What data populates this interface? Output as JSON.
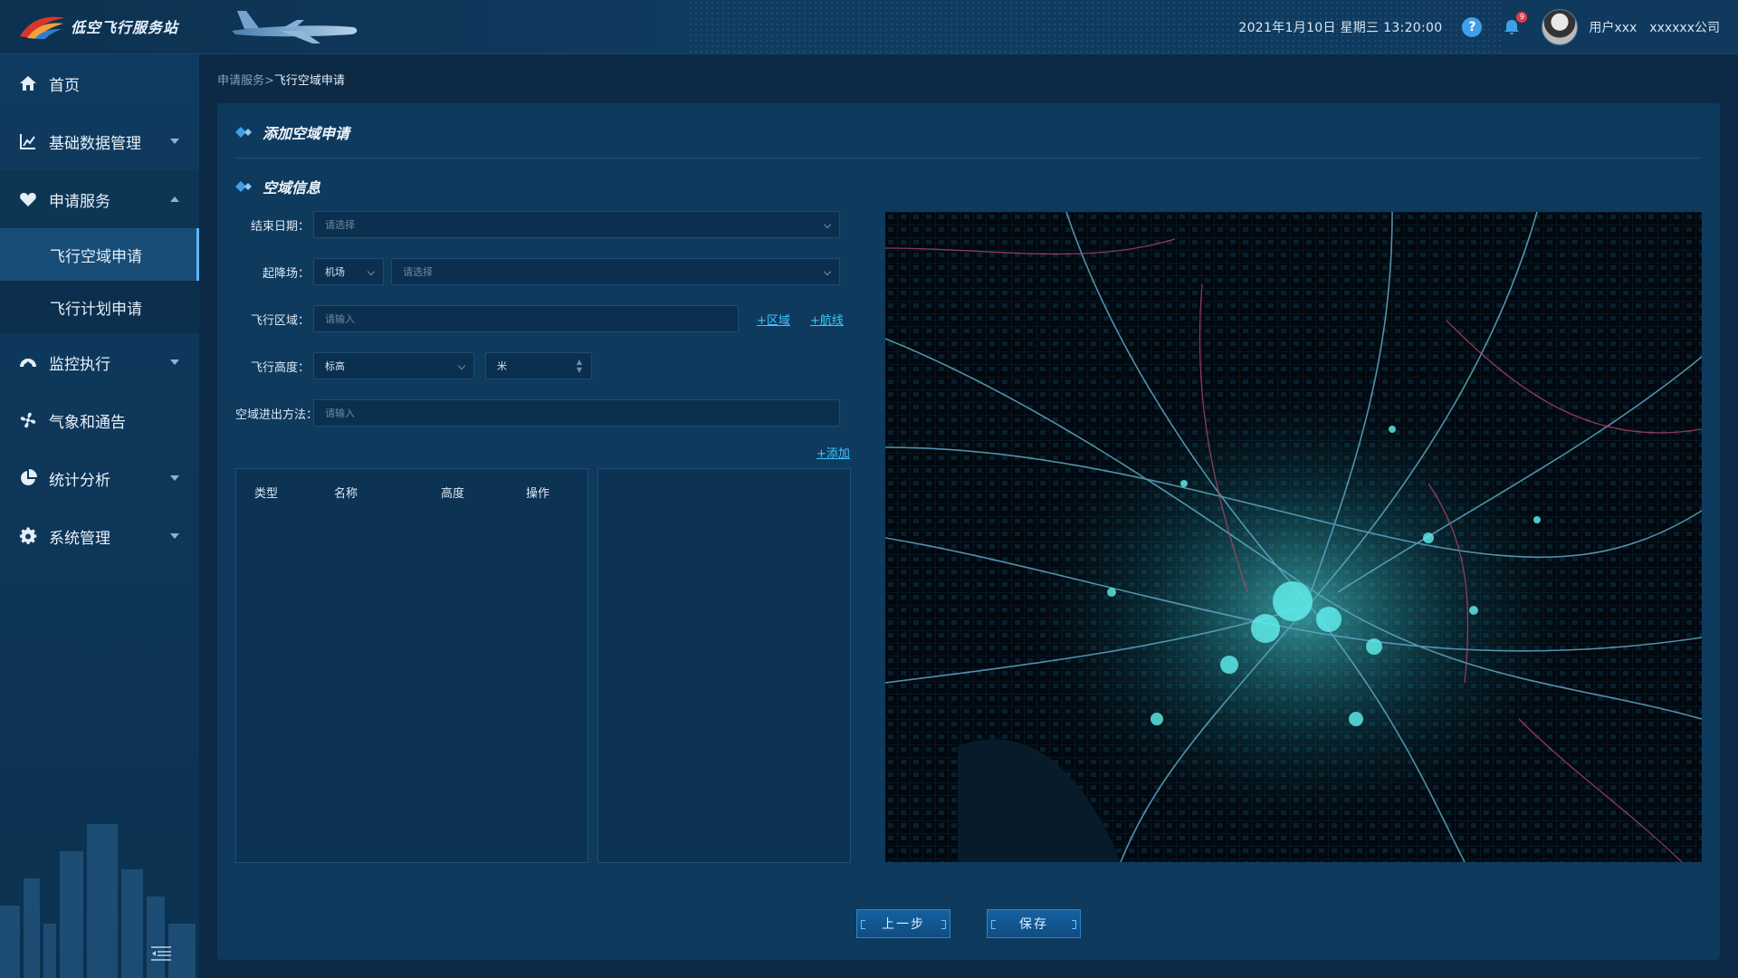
{
  "app": {
    "title": "低空飞行服务站"
  },
  "header": {
    "datetime": "2021年1月10日  星期三  13:20:00",
    "notification_count": "9",
    "user": "用户xxx",
    "company": "xxxxxx公司",
    "icons": [
      "help-icon",
      "bell-icon",
      "avatar"
    ]
  },
  "sidebar": {
    "items": [
      {
        "label": "首页",
        "icon": "home-icon"
      },
      {
        "label": "基础数据管理",
        "icon": "chart-icon"
      },
      {
        "label": "申请服务",
        "icon": "heart-icon"
      },
      {
        "label": "监控执行",
        "icon": "dashboard-icon"
      },
      {
        "label": "气象和通告",
        "icon": "fan-icon"
      },
      {
        "label": "统计分析",
        "icon": "pie-icon"
      },
      {
        "label": "系统管理",
        "icon": "gear-icon"
      }
    ],
    "sub_items": [
      {
        "label": "飞行空域申请",
        "active": true
      },
      {
        "label": "飞行计划申请",
        "active": false
      }
    ]
  },
  "breadcrumb": {
    "parent": "申请服务>",
    "current": "飞行空域申请"
  },
  "page": {
    "section1": "添加空域申请",
    "section2": "空域信息"
  },
  "form": {
    "end_date": {
      "label": "结束日期：",
      "placeholder": "请选择"
    },
    "airport": {
      "label": "起降场：",
      "type_value": "机场",
      "placeholder": "请选择"
    },
    "area": {
      "label": "飞行区域：",
      "placeholder": "请输入",
      "add_area": "+区域",
      "add_route": "+航线"
    },
    "altitude": {
      "label": "飞行高度：",
      "type_value": "标高",
      "unit_value": "米"
    },
    "entry_method": {
      "label": "空域进出方法：",
      "placeholder": "请输入"
    },
    "add_link": "+添加"
  },
  "table": {
    "columns": [
      "类型",
      "名称",
      "高度",
      "操作"
    ]
  },
  "buttons": {
    "prev": "上一步",
    "save": "保存"
  },
  "colors": {
    "accent": "#3fc6ff",
    "panel": "#0e3a5d",
    "sidebar": "#0f3b60",
    "active": "#174d77"
  }
}
